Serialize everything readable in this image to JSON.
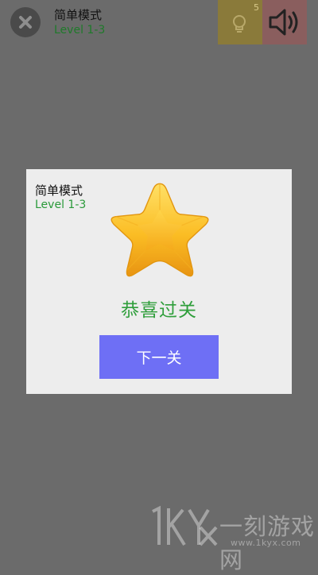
{
  "header": {
    "mode_title": "简单模式",
    "level": "Level 1-3",
    "hint_count": "5",
    "icons": [
      "close-icon",
      "lightbulb-icon",
      "speaker-icon"
    ]
  },
  "dialog": {
    "mode_title": "简单模式",
    "level": "Level 1-3",
    "message": "恭喜过关",
    "next_button": "下一关",
    "star_icon": "star-icon"
  },
  "watermark": {
    "text": "一刻游戏网",
    "url": "www.1kyx.com",
    "logo": "1KYX"
  },
  "colors": {
    "overlay": "#6b6b6b",
    "dialog_bg": "#ededed",
    "accent_green": "#2f9e3b",
    "button_blue": "#6e6ff5",
    "star_gold": "#f7b81e"
  }
}
